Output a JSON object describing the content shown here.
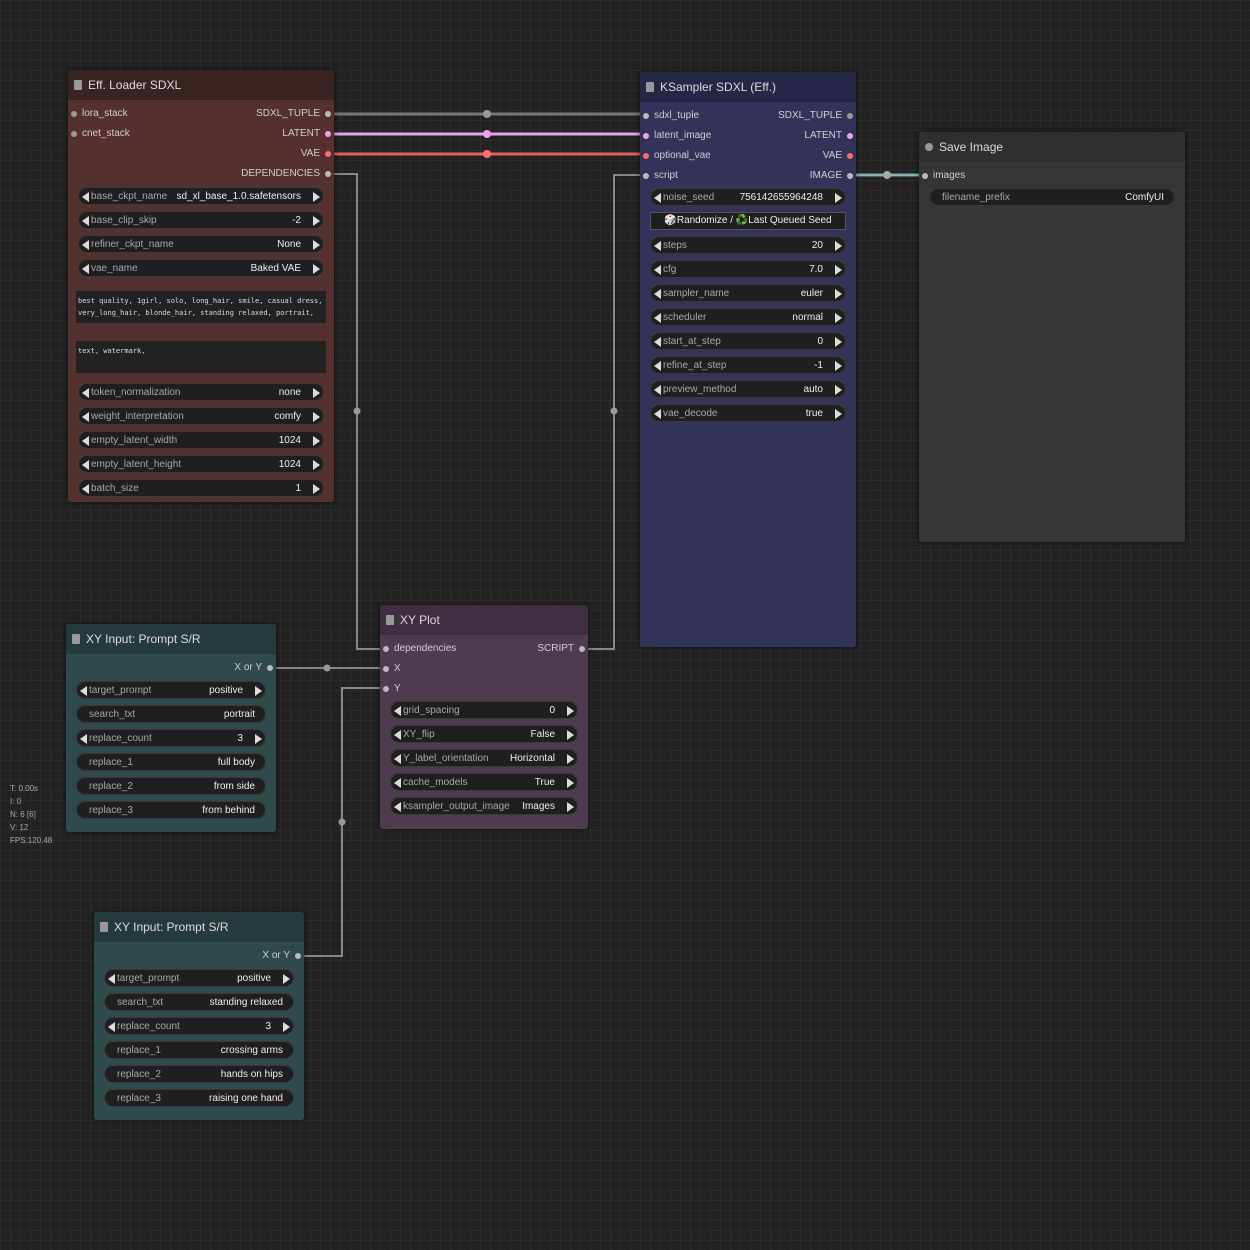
{
  "stats": [
    "T: 0.00s",
    "I: 0",
    "N: 6 [6]",
    "V: 12",
    "FPS:120.48"
  ],
  "colors": {
    "background": "#222222",
    "loader_body": "#543030",
    "loader_title": "#332121",
    "ksampler_body": "#33335a",
    "ksampler_title": "#222244",
    "xyplot_body": "#4f3b50",
    "xyinput_body": "#2f4a4a",
    "save_body": "#353535"
  },
  "loader": {
    "title": "Eff. Loader SDXL",
    "inputs": [
      "lora_stack",
      "cnet_stack"
    ],
    "outputs": [
      "SDXL_TUPLE",
      "LATENT",
      "VAE",
      "DEPENDENCIES"
    ],
    "widgets_top": [
      {
        "label": "base_ckpt_name",
        "value": "sd_xl_base_1.0.safetensors"
      },
      {
        "label": "base_clip_skip",
        "value": "-2"
      },
      {
        "label": "refiner_ckpt_name",
        "value": "None"
      },
      {
        "label": "vae_name",
        "value": "Baked VAE"
      }
    ],
    "positive": "best quality, 1girl, solo, long_hair, smile, casual dress, very_long_hair, blonde_hair, standing relaxed, portrait,",
    "negative": "text, watermark,",
    "widgets_bottom": [
      {
        "label": "token_normalization",
        "value": "none"
      },
      {
        "label": "weight_interpretation",
        "value": "comfy"
      },
      {
        "label": "empty_latent_width",
        "value": "1024"
      },
      {
        "label": "empty_latent_height",
        "value": "1024"
      },
      {
        "label": "batch_size",
        "value": "1"
      }
    ]
  },
  "ksampler": {
    "title": "KSampler SDXL (Eff.)",
    "inputs": [
      "sdxl_tuple",
      "latent_image",
      "optional_vae",
      "script"
    ],
    "outputs": [
      "SDXL_TUPLE",
      "LATENT",
      "VAE",
      "IMAGE"
    ],
    "noise_seed": {
      "label": "noise_seed",
      "value": "756142655964248"
    },
    "seed_button": "🎲Randomize / ♻️Last Queued Seed",
    "widgets": [
      {
        "label": "steps",
        "value": "20"
      },
      {
        "label": "cfg",
        "value": "7.0"
      },
      {
        "label": "sampler_name",
        "value": "euler"
      },
      {
        "label": "scheduler",
        "value": "normal"
      },
      {
        "label": "start_at_step",
        "value": "0"
      },
      {
        "label": "refine_at_step",
        "value": "-1"
      },
      {
        "label": "preview_method",
        "value": "auto"
      },
      {
        "label": "vae_decode",
        "value": "true"
      }
    ]
  },
  "save": {
    "title": "Save Image",
    "input": "images",
    "filename_prefix": {
      "label": "filename_prefix",
      "value": "ComfyUI"
    }
  },
  "xyplot": {
    "title": "XY Plot",
    "inputs": [
      "dependencies",
      "X",
      "Y"
    ],
    "output": "SCRIPT",
    "widgets": [
      {
        "label": "grid_spacing",
        "value": "0"
      },
      {
        "label": "XY_flip",
        "value": "False"
      },
      {
        "label": "Y_label_orientation",
        "value": "Horizontal"
      },
      {
        "label": "cache_models",
        "value": "True"
      },
      {
        "label": "ksampler_output_image",
        "value": "Images"
      }
    ]
  },
  "xy1": {
    "title": "XY Input: Prompt S/R",
    "output": "X or Y",
    "widgets": [
      {
        "label": "target_prompt",
        "value": "positive",
        "arrow": true
      },
      {
        "label": "search_txt",
        "value": "portrait",
        "arrow": false
      },
      {
        "label": "replace_count",
        "value": "3",
        "arrow": true
      },
      {
        "label": "replace_1",
        "value": "full body",
        "arrow": false
      },
      {
        "label": "replace_2",
        "value": "from side",
        "arrow": false
      },
      {
        "label": "replace_3",
        "value": "from behind",
        "arrow": false
      }
    ]
  },
  "xy2": {
    "title": "XY Input: Prompt S/R",
    "output": "X or Y",
    "widgets": [
      {
        "label": "target_prompt",
        "value": "positive",
        "arrow": true
      },
      {
        "label": "search_txt",
        "value": "standing relaxed",
        "arrow": false
      },
      {
        "label": "replace_count",
        "value": "3",
        "arrow": true
      },
      {
        "label": "replace_1",
        "value": "crossing arms",
        "arrow": false
      },
      {
        "label": "replace_2",
        "value": "hands on hips",
        "arrow": false
      },
      {
        "label": "replace_3",
        "value": "raising one hand",
        "arrow": false
      }
    ]
  }
}
